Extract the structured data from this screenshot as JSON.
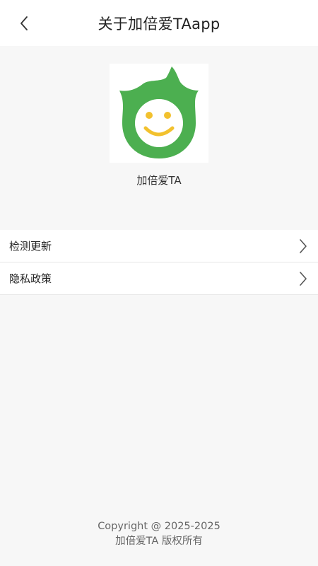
{
  "header": {
    "title": "关于加倍爱TAapp",
    "back_icon": "chevron-left-icon"
  },
  "about": {
    "logo_icon": "green-flame-smiley-logo",
    "app_name": "加倍爱TA"
  },
  "menu": {
    "items": [
      {
        "label": "检测更新",
        "icon": "chevron-right-icon"
      },
      {
        "label": "隐私政策",
        "icon": "chevron-right-icon"
      }
    ]
  },
  "footer": {
    "copyright": "Copyright @ 2025-2025",
    "rights": "加倍爱TA 版权所有"
  },
  "colors": {
    "logo_green": "#4caf50",
    "logo_smile": "#f2c12e",
    "background": "#f7f7f7"
  }
}
